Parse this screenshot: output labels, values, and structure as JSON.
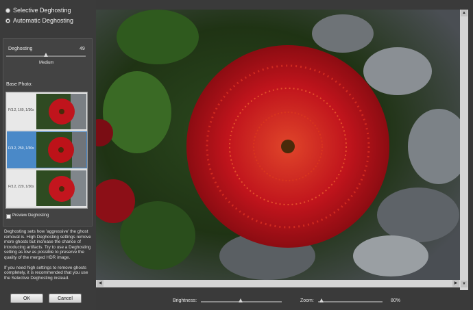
{
  "options": {
    "selective_label": "Selective Deghosting",
    "automatic_label": "Automatic Deghosting",
    "selected": "automatic"
  },
  "deghosting": {
    "label": "Deghosting",
    "value": "49",
    "level_label": "Medium"
  },
  "base_photo": {
    "label": "Base Photo:",
    "thumbnails": [
      {
        "caption": "F/3.2, 160, 1/30s",
        "selected": false
      },
      {
        "caption": "F/3.2, 250, 1/30s",
        "selected": true
      },
      {
        "caption": "F/3.2, 220, 1/30s",
        "selected": false
      }
    ]
  },
  "preview_checkbox": {
    "label": "Preview Deghosting",
    "checked": true
  },
  "help_text": {
    "para1": "Deghosting sets how 'aggressive' the ghost removal is. High Deghosting settings remove more ghosts but increase the chance of introducing artifacts. Try to use a Deghosting setting as low as possible to preserve the quality of the merged HDR image.",
    "para2": "If you need high settings to remove ghosts completely, it is recommended that you use the Selective Deghosting instead."
  },
  "buttons": {
    "ok": "OK",
    "cancel": "Cancel"
  },
  "bottom": {
    "brightness_label": "Brightness:",
    "zoom_label": "Zoom:",
    "zoom_value": "80%"
  },
  "colors": {
    "selection": "#4a89c8",
    "flower": "#c0141c"
  }
}
